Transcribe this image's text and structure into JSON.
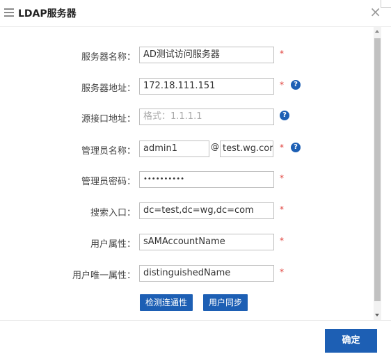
{
  "dialog": {
    "title": "LDAP服务器",
    "close_label": "×"
  },
  "form": {
    "server_name": {
      "label": "服务器名称：",
      "value": "AD测试访问服务器",
      "required": "*"
    },
    "server_address": {
      "label": "服务器地址：",
      "value": "172.18.111.151",
      "required": "*",
      "help": "?"
    },
    "source_ip": {
      "label": "源接口地址：",
      "placeholder": "格式：1.1.1.1",
      "help": "?"
    },
    "admin_name": {
      "label": "管理员名称：",
      "user": "admin1",
      "at": "@",
      "domain": "test.wg.cor",
      "required": "*",
      "help": "?"
    },
    "admin_password": {
      "label": "管理员密码：",
      "value": "••••••••••",
      "required": "*"
    },
    "search_base": {
      "label": "搜索入口：",
      "value": "dc=test,dc=wg,dc=com",
      "required": "*"
    },
    "user_attr": {
      "label": "用户属性：",
      "value": "sAMAccountName",
      "required": "*"
    },
    "user_unique_attr": {
      "label": "用户唯一属性：",
      "value": "distinguishedName",
      "required": "*"
    }
  },
  "actions": {
    "test_connection": "检测连通性",
    "sync_users": "用户同步",
    "ok": "确定"
  },
  "colors": {
    "accent": "#1d5fb4",
    "required": "#e0413b",
    "border": "#bfbfbf"
  }
}
